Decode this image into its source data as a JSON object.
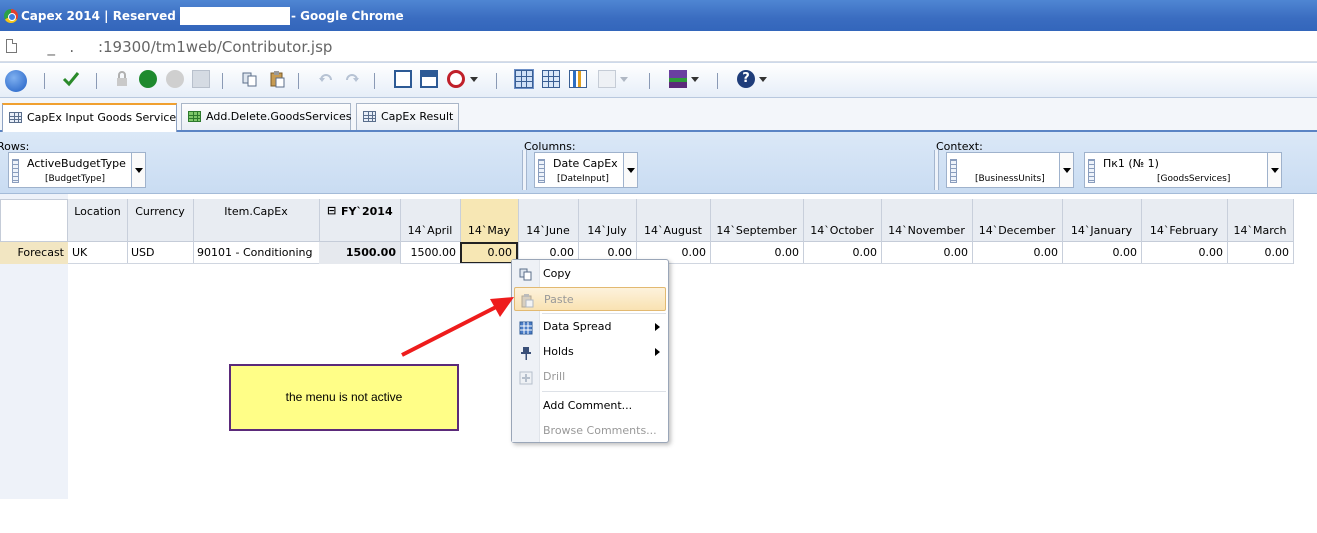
{
  "window": {
    "title_left": "Capex 2014 | Reserved | (",
    "title_right": "- Google Chrome"
  },
  "address": {
    "url": "  _   .     :19300/tm1web/Contributor.jsp"
  },
  "tabs": [
    {
      "label": "CapEx Input Goods Service",
      "active": true
    },
    {
      "label": "Add.Delete.GoodsServices",
      "active": false
    },
    {
      "label": "CapEx Result",
      "active": false
    }
  ],
  "dimensions": {
    "rows_label": "Rows:",
    "columns_label": "Columns:",
    "context_label": "Context:",
    "rows": {
      "name": "ActiveBudgetType",
      "sub": "[BudgetType]"
    },
    "columns": {
      "name": "Date CapEx",
      "sub": "[DateInput]"
    },
    "context": [
      {
        "name": "",
        "sub": "[BusinessUnits]"
      },
      {
        "name": "Пк1 (№ 1)",
        "sub": "[GoodsServices]"
      }
    ]
  },
  "grid": {
    "row_headers": [
      "Location",
      "Currency",
      "Item.CapEx"
    ],
    "fy_label": "FY`2014",
    "months": [
      "14`April",
      "14`May",
      "14`June",
      "14`July",
      "14`August",
      "14`September",
      "14`October",
      "14`November",
      "14`December",
      "14`January",
      "14`February",
      "14`March"
    ],
    "row": {
      "label": "Forecast",
      "location": "UK",
      "currency": "USD",
      "item": "90101 - Conditioning",
      "total": "1500.00",
      "values": [
        "1500.00",
        "0.00",
        "0.00",
        "0.00",
        "0.00",
        "0.00",
        "0.00",
        "0.00",
        "0.00",
        "0.00",
        "0.00",
        "0.00"
      ]
    }
  },
  "context_menu": {
    "items": [
      {
        "label": "Copy",
        "enabled": true
      },
      {
        "label": "Paste",
        "enabled": false
      },
      {
        "label": "Data Spread",
        "enabled": true
      },
      {
        "label": "Holds",
        "enabled": true
      },
      {
        "label": "Drill",
        "enabled": false
      },
      {
        "label": "Add Comment...",
        "enabled": true
      },
      {
        "label": "Browse Comments...",
        "enabled": false
      }
    ]
  },
  "annotation": {
    "text": "the menu is not active"
  },
  "colors": {
    "titlebar": "#3a6cc0",
    "selected_cell": "#f7e7b4",
    "annotation_bg": "#fffe87",
    "annotation_border": "#5b2a7a",
    "arrow": "#ee1c1c"
  }
}
